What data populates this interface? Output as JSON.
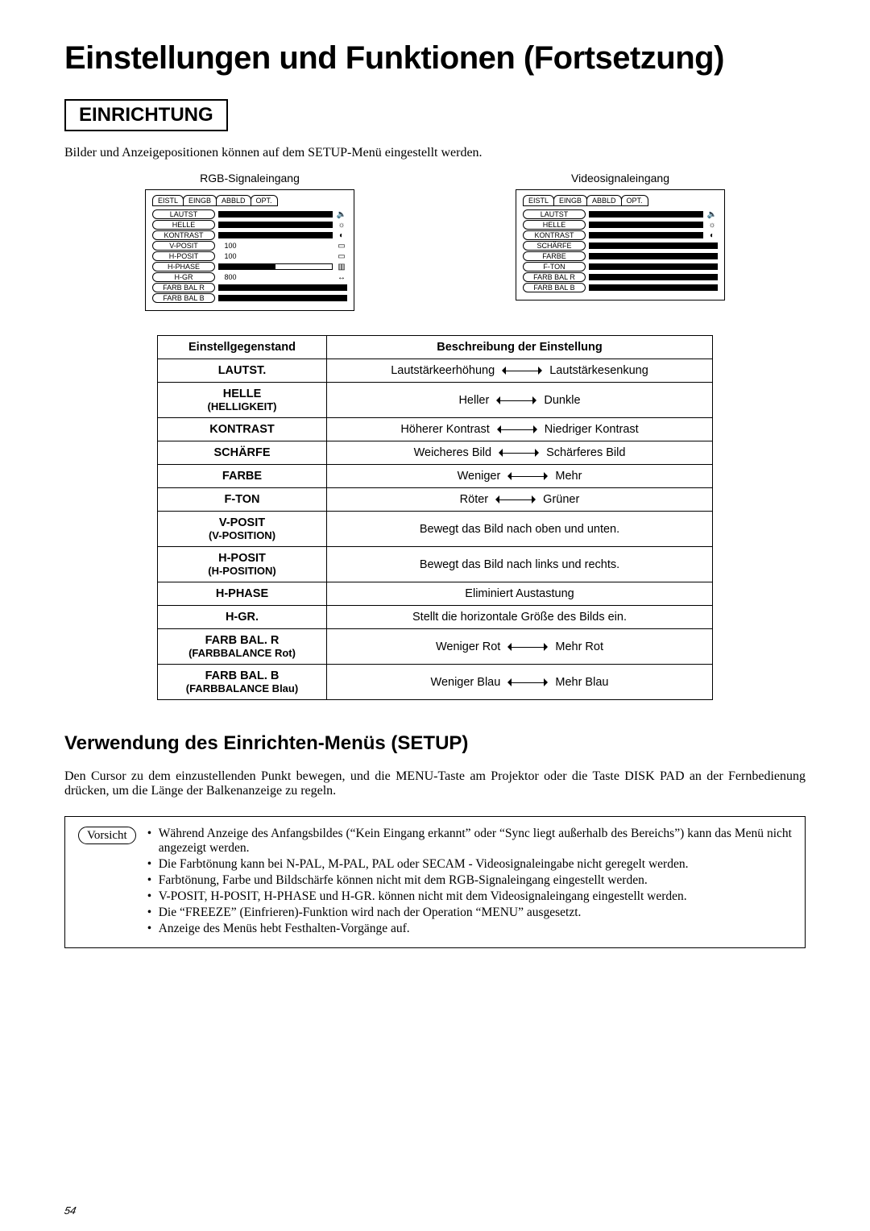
{
  "page_title": "Einstellungen und Funktionen (Fortsetzung)",
  "section": "EINRICHTUNG",
  "intro": "Bilder und Anzeigepositionen können auf dem SETUP-Menü eingestellt werden.",
  "osd": {
    "left_caption": "RGB-Signaleingang",
    "right_caption": "Videosignaleingang",
    "tabs": [
      "EISTL",
      "EINGB",
      "ABBLD",
      "OPT."
    ],
    "left_items": [
      {
        "label": "LAUTST",
        "bar": "full",
        "icon": "🔈"
      },
      {
        "label": "HELLE",
        "bar": "full",
        "icon": "☼"
      },
      {
        "label": "KONTRAST",
        "bar": "full",
        "icon": "◐"
      },
      {
        "label": "V-POSIT",
        "val": "100",
        "icon": "▭"
      },
      {
        "label": "H-POSIT",
        "val": "100",
        "icon": "▭"
      },
      {
        "label": "H-PHASE",
        "bar": "half",
        "icon": "▥"
      },
      {
        "label": "H-GR",
        "val": "800",
        "icon": "↔"
      },
      {
        "label": "FARB BAL  R",
        "bar": "full"
      },
      {
        "label": "FARB BAL  B",
        "bar": "full"
      }
    ],
    "right_items": [
      {
        "label": "LAUTST",
        "bar": "full",
        "icon": "🔈"
      },
      {
        "label": "HELLE",
        "bar": "full",
        "icon": "☼"
      },
      {
        "label": "KONTRAST",
        "bar": "full",
        "icon": "◐"
      },
      {
        "label": "SCHÄRFE",
        "bar": "full"
      },
      {
        "label": "FARBE",
        "bar": "full"
      },
      {
        "label": "F-TON",
        "bar": "full"
      },
      {
        "label": "FARB BAL R",
        "bar": "full"
      },
      {
        "label": "FARB BAL B",
        "bar": "full"
      }
    ]
  },
  "table": {
    "h1": "Einstellgegenstand",
    "h2": "Beschreibung der Einstellung",
    "rows": [
      {
        "item": "LAUTST.",
        "left": "Lautstärkeerhöhung",
        "right": "Lautstärkesenkung"
      },
      {
        "item": "HELLE",
        "sub": "(HELLIGKEIT)",
        "left": "Heller",
        "right": "Dunkle"
      },
      {
        "item": "KONTRAST",
        "left": "Höherer Kontrast",
        "right": "Niedriger Kontrast"
      },
      {
        "item": "SCHÄRFE",
        "left": "Weicheres Bild",
        "right": "Schärferes Bild"
      },
      {
        "item": "FARBE",
        "left": "Weniger",
        "right": "Mehr"
      },
      {
        "item": "F-TON",
        "left": "Röter",
        "right": "Grüner"
      },
      {
        "item": "V-POSIT",
        "sub": "(V-POSITION)",
        "text": "Bewegt das Bild nach oben und unten."
      },
      {
        "item": "H-POSIT",
        "sub": "(H-POSITION)",
        "text": "Bewegt das Bild nach links und rechts."
      },
      {
        "item": "H-PHASE",
        "text": "Eliminiert Austastung"
      },
      {
        "item": "H-GR.",
        "text": "Stellt die horizontale Größe des Bilds ein."
      },
      {
        "item": "FARB BAL. R",
        "sub": "(FARBBALANCE Rot)",
        "left": "Weniger Rot",
        "right": "Mehr Rot"
      },
      {
        "item": "FARB BAL. B",
        "sub": "(FARBBALANCE Blau)",
        "left": "Weniger Blau",
        "right": "Mehr Blau"
      }
    ]
  },
  "subheading": "Verwendung des Einrichten-Menüs (SETUP)",
  "subtext": "Den Cursor zu dem einzustellenden Punkt bewegen, und die MENU-Taste am Projektor oder die Taste DISK PAD an der Fernbedienung drücken, um die Länge der Balkenanzeige zu regeln.",
  "caution": {
    "label": "Vorsicht",
    "items": [
      "Während Anzeige des Anfangsbildes (“Kein Eingang erkannt” oder “Sync liegt außerhalb des Bereichs”) kann das Menü nicht angezeigt werden.",
      "Die Farbtönung kann bei N-PAL, M-PAL, PAL oder SECAM - Videosignaleingabe nicht geregelt werden.",
      "Farbtönung, Farbe und Bildschärfe können nicht mit dem RGB-Signaleingang eingestellt werden.",
      "V-POSIT, H-POSIT, H-PHASE und H-GR. können nicht mit dem Videosignaleingang eingestellt werden.",
      "Die “FREEZE” (Einfrieren)-Funktion wird nach der Operation “MENU” ausgesetzt.",
      "Anzeige des Menüs hebt Festhalten-Vorgänge auf."
    ]
  },
  "page_number": "54"
}
